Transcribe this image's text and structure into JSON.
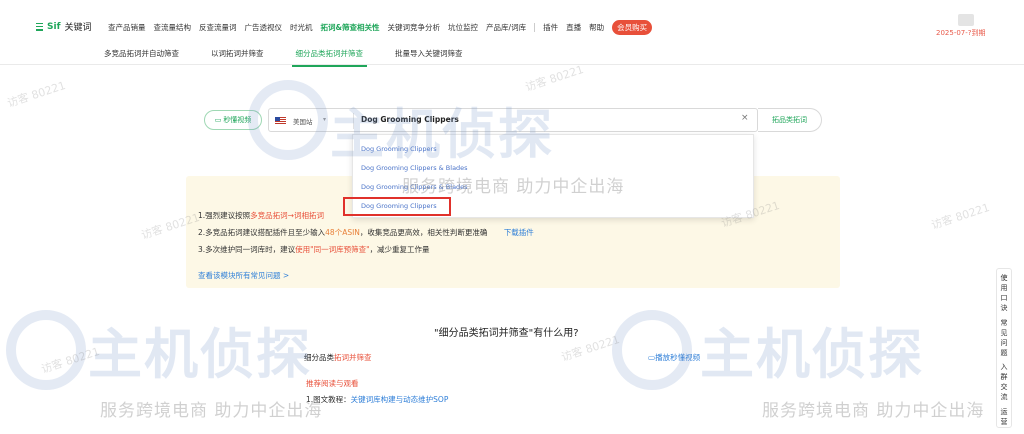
{
  "header": {
    "logo_text": "Sif",
    "logo_suffix": "关键词",
    "nav": [
      {
        "label": "查产品销量",
        "active": false
      },
      {
        "label": "查流量结构",
        "active": false
      },
      {
        "label": "反查流量词",
        "active": false
      },
      {
        "label": "广告透视仪",
        "active": false
      },
      {
        "label": "时光机",
        "active": false
      },
      {
        "label": "拓词&筛查相关性",
        "active": true
      },
      {
        "label": "关键词竞争分析",
        "active": false
      },
      {
        "label": "坑位监控",
        "active": false
      },
      {
        "label": "产品库/词库",
        "active": false
      }
    ],
    "nav_extra": [
      "插件",
      "直播",
      "帮助"
    ],
    "buy_label": "会员购买",
    "user_date": "2025-07-?到期"
  },
  "subnav": [
    {
      "label": "多竞品拓词并自动筛查",
      "active": false
    },
    {
      "label": "以词拓词并筛查",
      "active": false
    },
    {
      "label": "细分品类拓词并筛查",
      "active": true
    },
    {
      "label": "批量导入关键词筛查",
      "active": false
    }
  ],
  "search": {
    "video_label": "秒懂视频",
    "site": "美国站",
    "query": "Dog Grooming Clippers",
    "clear_icon": "×",
    "button_label": "拓品类拓词"
  },
  "suggestions": [
    "Dog Grooming Clippers",
    "Dog Grooming Clippers & Blades",
    "Dog Grooming Clippers & Blades",
    "Dog Grooming Clippers"
  ],
  "tips": {
    "line1_a": "1.强烈建议按照",
    "line1_b": "多竞品拓词→词相拓词",
    "line2_a": "2.多竞品拓词建议搭配插件且至少输入",
    "line2_b": "48个ASIN",
    "line2_c": "，收集竞品更高效，相关性判断更准确",
    "line2_link": "下载插件",
    "line3_a": "3.多次维护同一词库时，建议",
    "line3_b": "使用\"同一词库预筛查\"",
    "line3_c": "，减少重复工作量",
    "faq_link": "查看该模块所有常见问题 >"
  },
  "lower": {
    "title": "\"细分品类拓词并筛查\"有什么用?",
    "feature_a": "细分品类",
    "feature_b": "拓词并筛查",
    "play_link": "播放秒懂视频",
    "recommend": "推荐阅读与观看",
    "sop_a": "1.图文教程：",
    "sop_b": "关键词库构建与动态维护SOP"
  },
  "sidefloat": [
    "使",
    "用",
    "口",
    "诀",
    "",
    "常",
    "见",
    "问",
    "题",
    "",
    "入",
    "群",
    "交",
    "流",
    "",
    "运",
    "营"
  ],
  "watermark": {
    "logo": "主机侦探",
    "sub": "服务跨境电商 助力中企出海",
    "small": "访客 80221"
  }
}
